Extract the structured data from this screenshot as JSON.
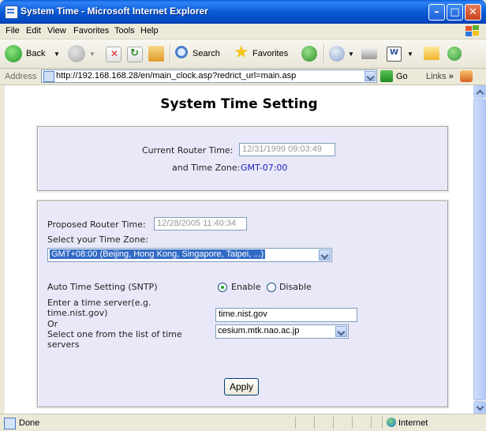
{
  "window": {
    "title": "System Time - Microsoft Internet Explorer"
  },
  "menu": [
    "File",
    "Edit",
    "View",
    "Favorites",
    "Tools",
    "Help"
  ],
  "toolbar": {
    "back": "Back",
    "search": "Search",
    "favorites": "Favorites"
  },
  "address": {
    "label": "Address",
    "url": "http://192.168.168.28/en/main_clock.asp?redrict_url=main.asp",
    "go": "Go",
    "links": "Links"
  },
  "page": {
    "heading": "System Time Setting",
    "current_label": "Current Router Time:",
    "current_value": "12/31/1999 09:03:49",
    "timezone_label": "and Time Zone:",
    "timezone_value": "GMT-07:00",
    "proposed_label": "Proposed Router Time:",
    "proposed_value": "12/28/2005 11:40:34",
    "select_tz_label": "Select your Time Zone:",
    "tz_selected": "GMT+08:00 (Beijing, Hong Kong, Singapore, Taipei, ...)",
    "sntp_label": "Auto Time Setting (SNTP)",
    "enable_label": "Enable",
    "disable_label": "Disable",
    "server_label_1": "Enter a time server(e.g.",
    "server_label_2": "time.nist.gov)",
    "server_value": "time.nist.gov",
    "or_label": "Or",
    "list_label_1": "Select one from the list of time",
    "list_label_2": "servers",
    "list_selected": "cesium.mtk.nao.ac.jp",
    "apply_label": "Apply"
  },
  "status": {
    "text": "Done",
    "zone": "Internet"
  }
}
